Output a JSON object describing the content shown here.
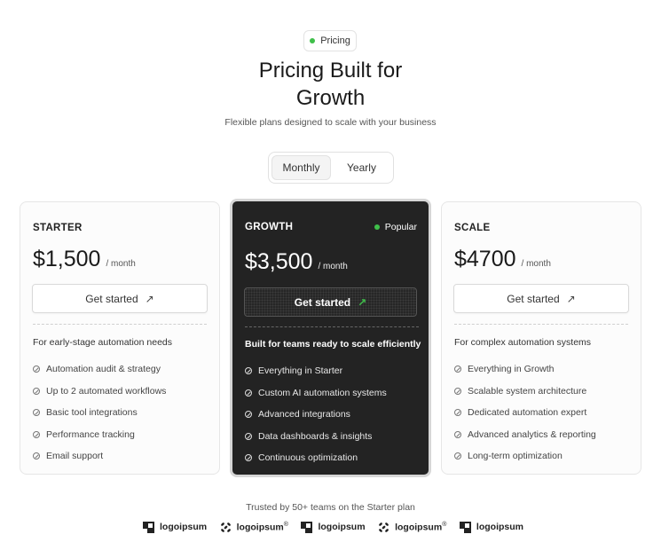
{
  "badge": {
    "label": "Pricing",
    "dot_color": "#3fbf4a"
  },
  "header": {
    "title_line1": "Pricing Built for",
    "title_line2": "Growth",
    "subtitle": "Flexible plans designed to scale with your business"
  },
  "billing_toggle": {
    "options": [
      "Monthly",
      "Yearly"
    ],
    "selected": "Monthly"
  },
  "plans": [
    {
      "name": "STARTER",
      "price": "$1,500",
      "period": "/ month",
      "cta": "Get started",
      "description": "For early-stage automation needs",
      "features": [
        "Automation audit & strategy",
        "Up to 2 automated workflows",
        "Basic tool integrations",
        "Performance tracking",
        "Email support"
      ]
    },
    {
      "name": "GROWTH",
      "badge": "Popular",
      "price": "$3,500",
      "period": "/ month",
      "cta": "Get started",
      "description": "Built for teams ready to scale efficiently",
      "features": [
        "Everything in Starter",
        "Custom AI automation systems",
        "Advanced integrations",
        "Data dashboards & insights",
        "Continuous optimization"
      ]
    },
    {
      "name": "SCALE",
      "price": "$4700",
      "period": "/ month",
      "cta": "Get started",
      "description": "For complex automation systems",
      "features": [
        "Everything in Growth",
        "Scalable system architecture",
        "Dedicated automation expert",
        "Advanced analytics & reporting",
        "Long-term optimization"
      ]
    }
  ],
  "trusted": {
    "text": "Trusted by 50+ teams on the Starter plan",
    "logos": [
      {
        "icon": "square-logo-icon",
        "name": "logoipsum",
        "mark": ""
      },
      {
        "icon": "petal-logo-icon",
        "name": "logoipsum",
        "mark": "®"
      },
      {
        "icon": "square-logo-icon",
        "name": "logoipsum",
        "mark": ""
      },
      {
        "icon": "petal-logo-icon",
        "name": "logoipsum",
        "mark": "®"
      },
      {
        "icon": "square-logo-icon",
        "name": "logoipsum",
        "mark": ""
      }
    ]
  },
  "colors": {
    "accent_green": "#3fbf4a",
    "dark_card": "#232323",
    "text": "#1f1f1f"
  }
}
